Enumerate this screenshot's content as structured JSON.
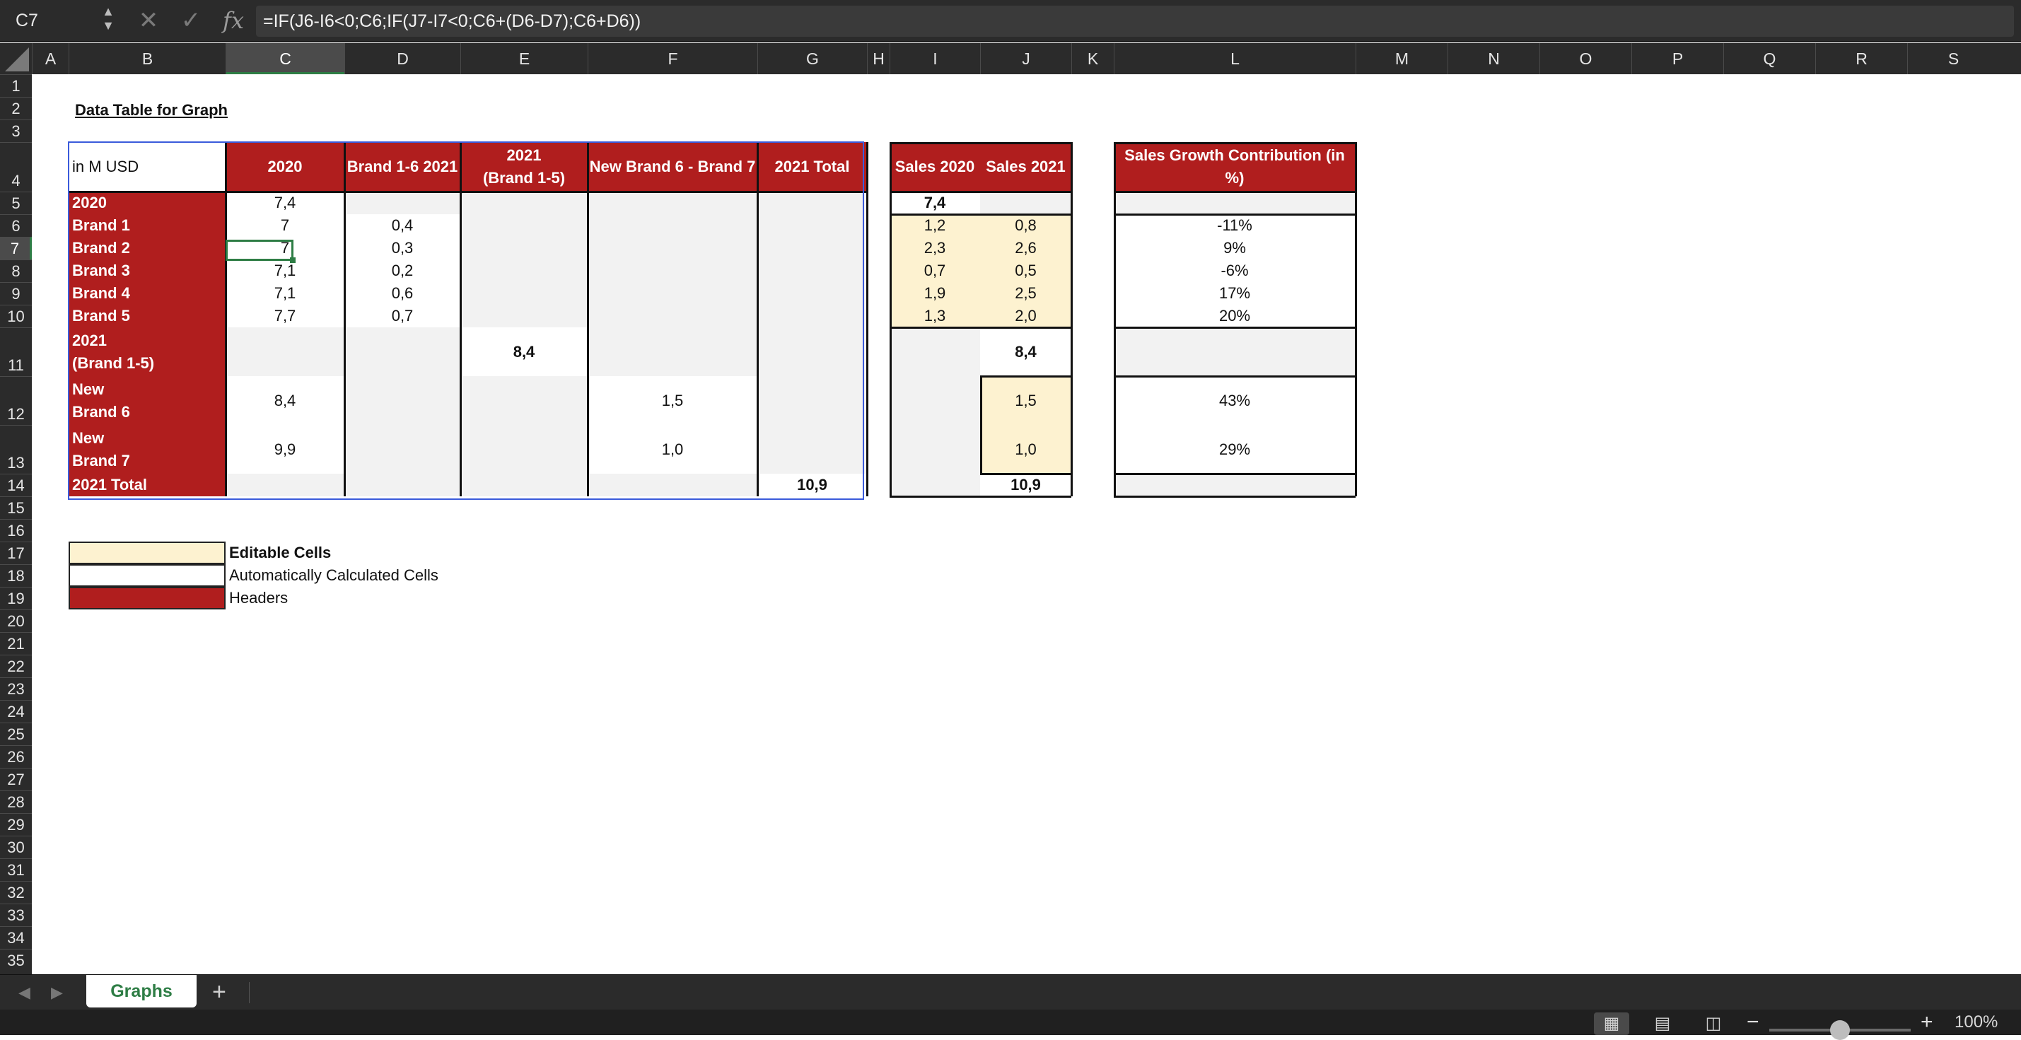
{
  "formula_bar": {
    "cell_ref": "C7",
    "formula": "=IF(J6-I6<0;C6;IF(J7-I7<0;C6+(D6-D7);C6+D6))",
    "fx_label": "fx"
  },
  "columns": [
    "A",
    "B",
    "C",
    "D",
    "E",
    "F",
    "G",
    "H",
    "I",
    "J",
    "K",
    "L",
    "M",
    "N",
    "O",
    "P",
    "Q",
    "R",
    "S"
  ],
  "rows": [
    "1",
    "2",
    "3",
    "4",
    "5",
    "6",
    "7",
    "8",
    "9",
    "10",
    "11",
    "12",
    "13",
    "14",
    "15",
    "16",
    "17",
    "18",
    "19",
    "20",
    "21",
    "22",
    "23",
    "24",
    "25",
    "26",
    "27",
    "28",
    "29",
    "30",
    "31",
    "32",
    "33",
    "34",
    "35"
  ],
  "sheet": {
    "title": "Data Table for Graph",
    "table": {
      "unit_label": "in M USD",
      "headers": [
        "2020",
        "Brand 1-6 2021",
        "2021\n(Brand 1-5)",
        "New Brand 6 - Brand 7",
        "2021 Total"
      ],
      "row_labels": [
        "2020",
        "Brand 1",
        "Brand 2",
        "Brand 3",
        "Brand 4",
        "Brand 5",
        "2021\n(Brand 1-5)",
        "New\nBrand 6",
        "New\nBrand 7",
        "2021 Total"
      ],
      "col_2020": [
        "7,4",
        "7",
        "7",
        "7,1",
        "7,1",
        "7,7",
        "",
        "8,4",
        "9,9",
        ""
      ],
      "col_brand16": [
        "",
        "0,4",
        "0,3",
        "0,2",
        "0,6",
        "0,7",
        "",
        "",
        "",
        ""
      ],
      "col_2021_b15": [
        "",
        "",
        "",
        "",
        "",
        "",
        "8,4",
        "",
        "",
        ""
      ],
      "col_new_brand": [
        "",
        "",
        "",
        "",
        "",
        "",
        "",
        "1,5",
        "1,0",
        ""
      ],
      "col_2021_total": [
        "",
        "",
        "",
        "",
        "",
        "",
        "",
        "",
        "",
        "10,9"
      ]
    },
    "sales": {
      "headers": [
        "Sales 2020",
        "Sales 2021"
      ],
      "sales_2020": [
        "7,4",
        "1,2",
        "2,3",
        "0,7",
        "1,9",
        "1,3",
        "",
        "",
        "",
        ""
      ],
      "sales_2021": [
        "",
        "0,8",
        "2,6",
        "0,5",
        "2,5",
        "2,0",
        "8,4",
        "1,5",
        "1,0",
        "10,9"
      ]
    },
    "growth": {
      "header": "Sales Growth Contribution (in %)",
      "values": [
        "",
        "-11%",
        "9%",
        "-6%",
        "17%",
        "20%",
        "",
        "43%",
        "29%",
        ""
      ]
    },
    "legend": [
      {
        "label": "Editable Cells",
        "color": "#fdf2d0"
      },
      {
        "label": "Automatically Calculated Cells",
        "color": "#ffffff"
      },
      {
        "label": "Headers",
        "color": "#b01e1e"
      }
    ]
  },
  "tabs": {
    "sheet_name": "Graphs",
    "add_label": "+"
  },
  "status": {
    "zoom": "100%"
  },
  "colors": {
    "header_red": "#b01e1e",
    "editable_cream": "#fdf2d0",
    "selection_green": "#2e7d45",
    "table_border_blue": "#3b5bdb"
  }
}
